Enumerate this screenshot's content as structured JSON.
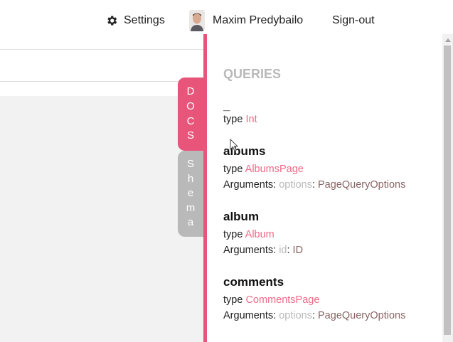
{
  "header": {
    "settings_label": "Settings",
    "user_name": "Maxim Predybailo",
    "signout_label": "Sign-out",
    "icons": {
      "settings": "gear-icon",
      "user": "avatar"
    }
  },
  "tabs": {
    "docs_letters": [
      "D",
      "O",
      "C",
      "S"
    ],
    "shema_letters": [
      "S",
      "h",
      "e",
      "m",
      "a"
    ]
  },
  "docs": {
    "section_title": "QUERIES",
    "queries": [
      {
        "name": "_",
        "type_label": "type",
        "type": "Int"
      },
      {
        "name": "albums",
        "type_label": "type",
        "type": "AlbumsPage",
        "args_label": "Arguments:",
        "arg_name": "options",
        "arg_sep": ":",
        "arg_type": "PageQueryOptions"
      },
      {
        "name": "album",
        "type_label": "type",
        "type": "Album",
        "args_label": "Arguments:",
        "arg_name": "id",
        "arg_sep": ":",
        "arg_type": "ID"
      },
      {
        "name": "comments",
        "type_label": "type",
        "type": "CommentsPage",
        "args_label": "Arguments:",
        "arg_name": "options",
        "arg_sep": ":",
        "arg_type": "PageQueryOptions"
      }
    ]
  },
  "colors": {
    "accent": "#e8557a",
    "type_color": "#f06a87",
    "muted": "#b9b9b9",
    "arg_type": "#8a6464"
  }
}
